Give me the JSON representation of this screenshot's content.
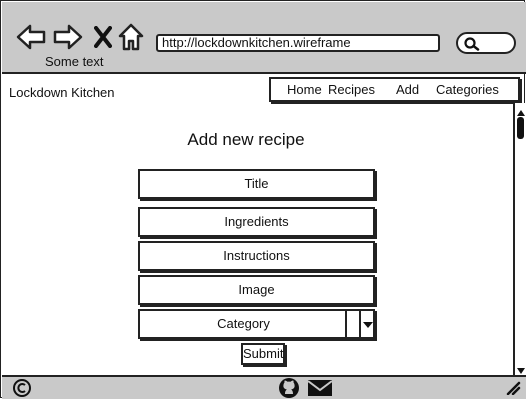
{
  "browser": {
    "status_text": "Some text",
    "url": "http://lockdownkitchen.wireframe"
  },
  "header": {
    "site_title": "Lockdown Kitchen",
    "nav": [
      {
        "label": "Home"
      },
      {
        "label": "Recipes"
      },
      {
        "label": "Add"
      },
      {
        "label": "Categories"
      }
    ]
  },
  "form": {
    "heading": "Add new recipe",
    "fields": [
      {
        "label": "Title"
      },
      {
        "label": "Ingredients"
      },
      {
        "label": "Instructions"
      },
      {
        "label": "Image"
      },
      {
        "label": "Category"
      }
    ],
    "submit_label": "Submit"
  },
  "icons": {
    "back": "arrow-left-icon",
    "forward": "arrow-right-icon",
    "stop": "close-icon",
    "home": "home-icon",
    "search": "search-icon",
    "copyright": "copyright-icon",
    "github": "github-icon",
    "mail": "mail-icon",
    "resize": "resize-grip-icon",
    "dropdown": "chevron-down-icon"
  }
}
